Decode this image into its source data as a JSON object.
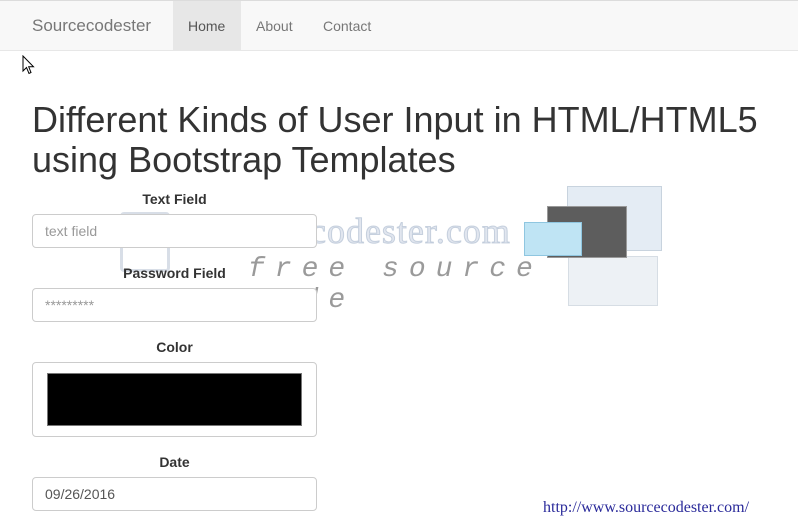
{
  "navbar": {
    "brand": "Sourcecodester",
    "items": [
      {
        "label": "Home",
        "active": true
      },
      {
        "label": "About",
        "active": false
      },
      {
        "label": "Contact",
        "active": false
      }
    ]
  },
  "page": {
    "title": "Different Kinds of User Input in HTML/HTML5 using Bootstrap Templates"
  },
  "form": {
    "text_field": {
      "label": "Text Field",
      "placeholder": "text field",
      "value": ""
    },
    "password_field": {
      "label": "Password Field",
      "placeholder": "*********",
      "value": ""
    },
    "color_field": {
      "label": "Color",
      "value": "#000000"
    },
    "date_field": {
      "label": "Date",
      "value": "09/26/2016"
    }
  },
  "watermark": {
    "logo_text": "Sourcecodester.com",
    "tagline": "free source code",
    "url": "http://www.sourcecodester.com/"
  }
}
